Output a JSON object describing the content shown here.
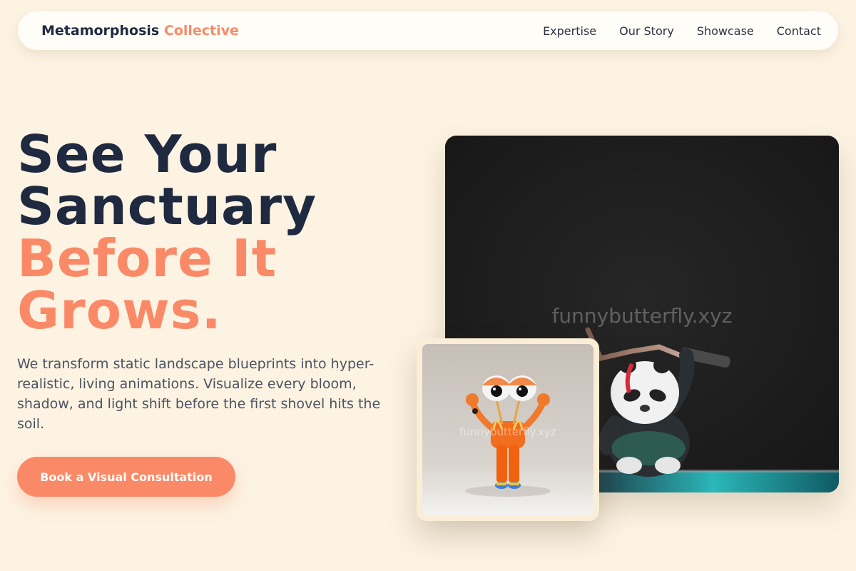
{
  "brand": {
    "name_primary": "Metamorphosis",
    "name_accent": "Collective"
  },
  "nav": {
    "links": [
      "Expertise",
      "Our Story",
      "Showcase",
      "Contact"
    ]
  },
  "hero": {
    "title_line_1": "See Your",
    "title_line_2": "Sanctuary",
    "title_line_3": "Before It",
    "title_line_4": "Grows.",
    "description": "We transform static landscape blueprints into hyper-realistic, living animations. Visualize every bloom, shadow, and light shift before the first shovel hits the soil.",
    "cta_label": "Book a Visual Consultation"
  },
  "images": {
    "main_watermark": "funnybutterfly.xyz",
    "inset_watermark": "funnybutterfly.xyz",
    "main_subject": "panda warrior figurine",
    "inset_subject": "orange toy character with googly eyes"
  },
  "colors": {
    "background": "#fdf3e3",
    "accent": "#fa8a67",
    "heading": "#1f2a40",
    "body_text": "#4c5260"
  }
}
